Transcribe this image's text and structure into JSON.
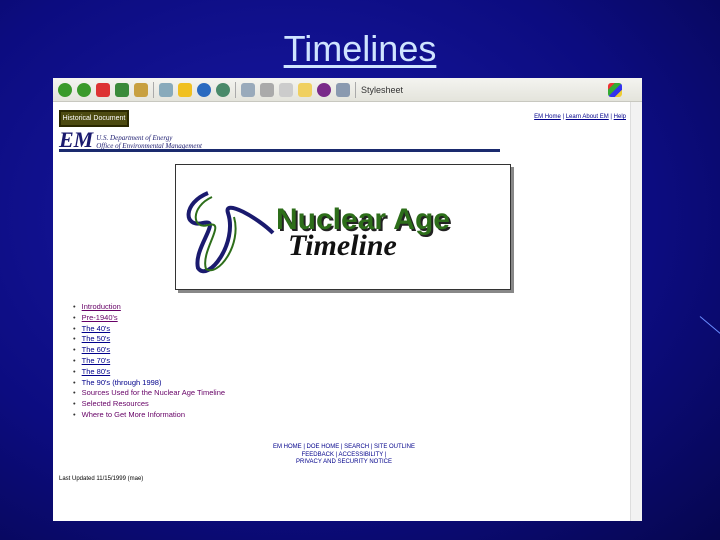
{
  "slide": {
    "title": "Timelines"
  },
  "browser": {
    "toolbar_text": "Stylesheet"
  },
  "page": {
    "historical_label": "Historical Document",
    "top_links": [
      "EM Home",
      "Learn About EM",
      "Help"
    ],
    "em_logo": "EM",
    "em_line1": "U.S. Department of Energy",
    "em_line2": "Office of Environmental Management",
    "banner_line1": "Nuclear Age",
    "banner_line2": "Timeline",
    "nav": [
      "Introduction",
      "Pre-1940's",
      "The 40's",
      "The 50's",
      "The 60's",
      "The 70's",
      "The 80's",
      "The 90's (through 1998)",
      "Sources Used for the Nuclear Age Timeline",
      "Selected Resources",
      "Where to Get More Information"
    ],
    "footer": [
      "EM HOME | DOE HOME | SEARCH | SITE OUTLINE",
      "FEEDBACK | ACCESSIBILITY |",
      "PRIVACY AND SECURITY NOTICE"
    ],
    "last_updated": "Last Updated 11/15/1999 (mae)"
  }
}
